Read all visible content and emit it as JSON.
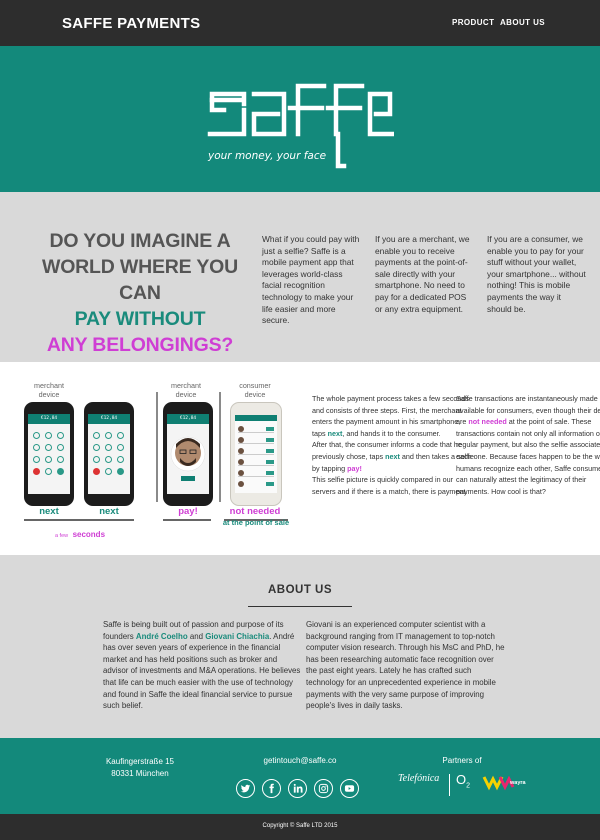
{
  "nav": {
    "brand": "SAFFE PAYMENTS",
    "links": [
      "PRODUCT",
      "ABOUT US"
    ]
  },
  "hero": {
    "logo_text": "saffe",
    "tagline": "your money, your face"
  },
  "intro": {
    "headline": [
      "DO YOU IMAGINE A",
      "WORLD WHERE  YOU CAN",
      "PAY WITHOUT",
      "ANY BELONGINGS?"
    ],
    "columns": [
      "What if you could pay with just a selfie? Saffe is a mobile payment app that leverages world-class facial recognition technology to make your life easier and more secure.",
      "If you are a merchant, we enable you to receive payments at the point-of-sale directly with your smartphone. No need to pay for a dedicated POS or any extra equipment.",
      "If you are a consumer, we enable you to pay for your stuff without your wallet, your smartphone... without nothing! This is mobile payments the way it should be."
    ]
  },
  "steps": {
    "merchant_device_1": "merchant\ndevice",
    "merchant_device_2": "merchant\ndevice",
    "consumer_device": "consumer\ndevice",
    "screen_amount": "€12,84",
    "step1": "next",
    "step2": "next",
    "step3": "pay!",
    "step4": "not needed",
    "point_of_sale": "at the point of sale",
    "few": "a few",
    "seconds": "seconds",
    "col1": {
      "p1": "The whole payment process takes a few seconds and consists of three steps. First, the merchant enters the payment amount in his smartphone, taps ",
      "p1_next": "next",
      "p1_end": ", and hands it to the consumer.",
      "p2": "After that, the consumer informs a code that he previously chose, taps ",
      "p2_next": "next",
      "p2_mid": " and then takes a selfie by tapping ",
      "p2_pay": "pay!",
      "p3": "This selfie picture is quickly compared in our servers and if there is a match, there is payment."
    },
    "col2": {
      "a": "Saffe transactions are instantaneously made available for consumers, even though their devices are ",
      "not_needed": "not needed",
      "b": " at the point of sale. These transactions contain not only all information of a regular payment, but also the selfie associated to each one. Because faces happen to be the way humans recognize each other, Saffe consumers can naturally attest the legitimacy of their payments. How cool is that?"
    }
  },
  "about": {
    "title": "ABOUT US",
    "col1_a": "Saffe is being built out of passion and purpose of its founders ",
    "founder1": "André Coelho",
    "col1_and": " and ",
    "founder2": "Giovani Chiachia",
    "col1_b": ". André has over seven years of experience in the financial market and has held positions such as broker and advisor of investments and M&A operations. He believes that life can be much easier with the use of technology and found in Saffe the ideal financial service to pursue such belief.",
    "col2": "Giovani is an experienced computer scientist with a background ranging from IT management to top-notch computer vision research. Through his MsC and PhD, he has been researching automatic face recognition over the past eight years. Lately he has crafted such technology for an unprecedented experience in mobile payments with the very same purpose of improving people's lives in daily tasks."
  },
  "footer": {
    "address_line1": "Kaufingerstraße 15",
    "address_line2": "80331 München",
    "email": "getintouch@saffe.co",
    "partners_label": "Partners of",
    "partner1": "Telefónica",
    "partner2": "O",
    "partner2_sub": "2",
    "partner3": "wayra",
    "social_icons": [
      "twitter-icon",
      "facebook-icon",
      "linkedin-icon",
      "instagram-icon",
      "youtube-icon"
    ],
    "copyright": "Copyright © Saffe LTD 2015"
  },
  "colors": {
    "teal": "#13897b",
    "dark": "#2d2d2d",
    "grey": "#d9d9d9",
    "pink": "#cf3ed4"
  }
}
